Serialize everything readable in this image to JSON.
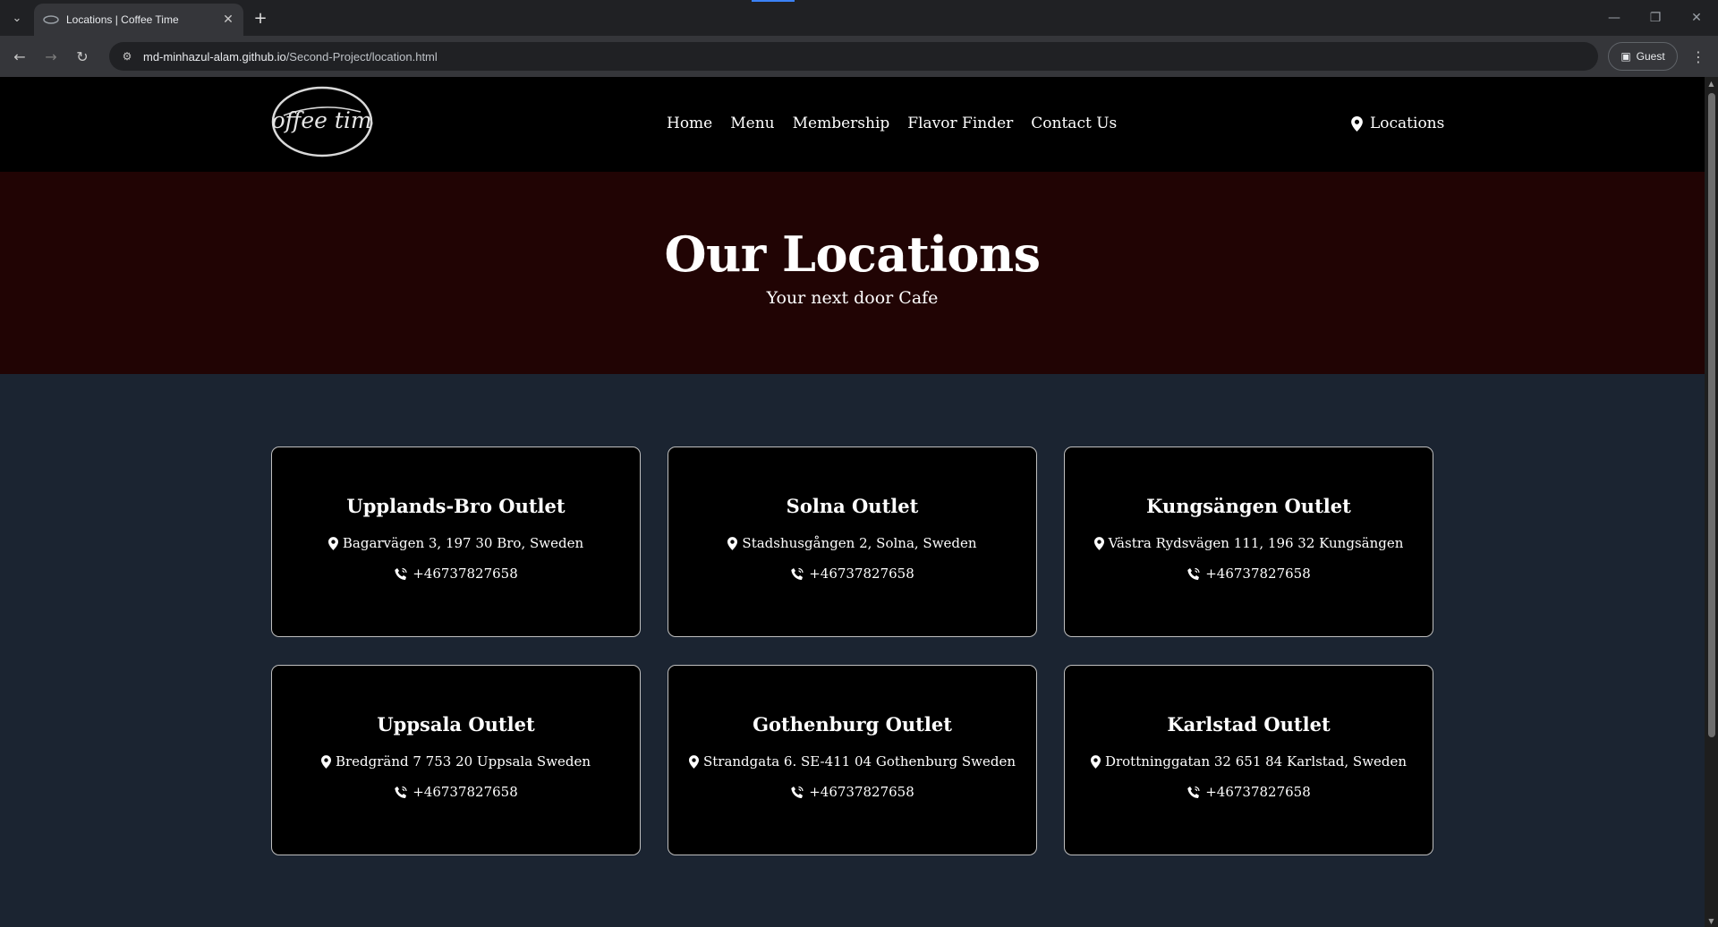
{
  "browser": {
    "tab_title": "Locations | Coffee Time",
    "url_host": "md-minhazul-alam.github.io",
    "url_path": "/Second-Project/location.html",
    "profile_label": "Guest"
  },
  "header": {
    "logo_text": "coffee time",
    "nav": [
      "Home",
      "Menu",
      "Membership",
      "Flavor Finder",
      "Contact Us"
    ],
    "locations_label": "Locations"
  },
  "hero": {
    "title": "Our Locations",
    "subtitle": "Your next door Cafe"
  },
  "locations": [
    {
      "name": "Upplands-Bro Outlet",
      "address": "Bagarvägen 3, 197 30 Bro, Sweden",
      "phone": "+46737827658"
    },
    {
      "name": "Solna Outlet",
      "address": "Stadshusgången 2, Solna, Sweden",
      "phone": "+46737827658"
    },
    {
      "name": "Kungsängen Outlet",
      "address": "Västra Rydsvägen 111, 196 32 Kungsängen",
      "phone": "+46737827658"
    },
    {
      "name": "Uppsala Outlet",
      "address": "Bredgränd 7 753 20 Uppsala Sweden",
      "phone": "+46737827658"
    },
    {
      "name": "Gothenburg Outlet",
      "address": "Strandgata 6. SE-411 04 Gothenburg Sweden",
      "phone": "+46737827658"
    },
    {
      "name": "Karlstad Outlet",
      "address": "Drottninggatan 32 651 84 Karlstad, Sweden",
      "phone": "+46737827658"
    }
  ],
  "colors": {
    "header_bg": "#000000",
    "hero_bg": "#210404",
    "page_bg": "#1b2431",
    "card_bg": "#000000",
    "card_border": "#bfbfbf"
  }
}
